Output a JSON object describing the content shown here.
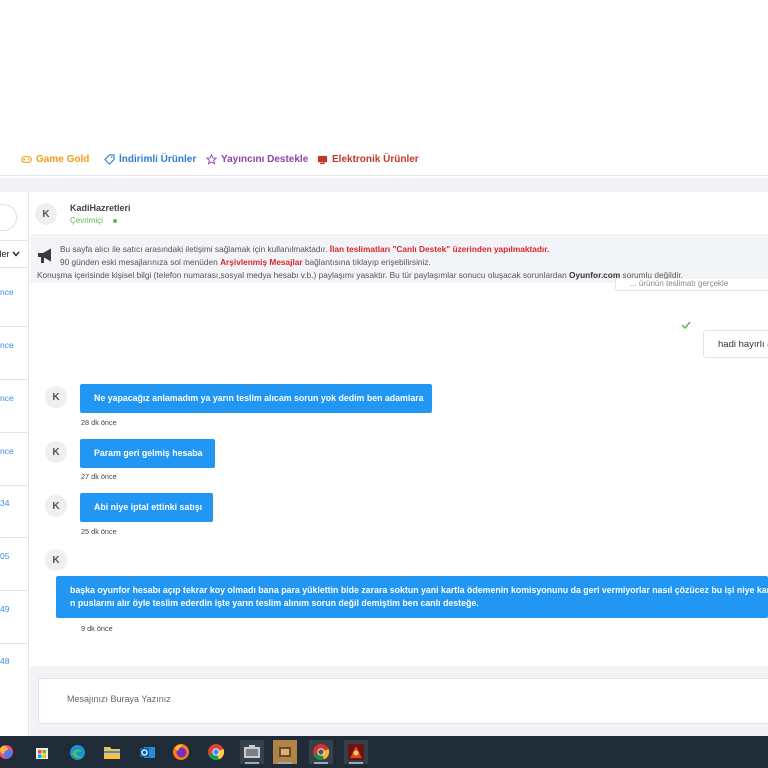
{
  "colors": {
    "accent_blue": "#2196f3",
    "link_blue": "#3a8ee6",
    "online_green": "#5cb85c",
    "alert_red": "#d9262c",
    "nav_game_gold": "#f39c12",
    "nav_discount": "#2d7dd2",
    "nav_streamer": "#8e44ad",
    "nav_electronics": "#c0392b"
  },
  "nav": {
    "items": [
      {
        "label": "Game Gold",
        "icon": "gamepad-icon"
      },
      {
        "label": "İndirimli Ürünler",
        "icon": "tag-icon"
      },
      {
        "label": "Yayıncını Destekle",
        "icon": "star-icon"
      },
      {
        "label": "Elektronik Ürünler",
        "icon": "electronics-icon"
      }
    ]
  },
  "sidebar": {
    "filter_label": "tler",
    "times": [
      "nce",
      "nce",
      "nce",
      "nce",
      "34",
      "05",
      "49",
      "48"
    ]
  },
  "chat": {
    "contact": {
      "initial": "K",
      "name": "KadiHazretleri",
      "status": "Çevrimiçi"
    },
    "notice": {
      "line1_plain": "Bu sayfa alıcı ile satıcı arasındaki iletişimi sağlamak için kullanılmaktadır.",
      "line1_red": "İlan teslimatları \"Canlı Destek\" üzerinden yapılmaktadır.",
      "line2_before": "90 günden eski mesajlarınıza sol menüden",
      "line2_red": "Arşivlenmiş Mesajlar",
      "line2_after": "bağlantısına tıklayıp erişebilirsiniz.",
      "line3_before": "Konuşma içerisinde kişisel bilgi (telefon numarası,sosyal medya hesabı v.b.) paylaşımı yasaktır. Bu tür paylaşımlar sonucu oluşacak sorunlardan",
      "line3_bold": "Oyunfor.com",
      "line3_after": "sorumlu değildir."
    },
    "partial_bubble_text": "... ürünün teslimatı gerçekle",
    "outgoing_last": "hadi hayırlı a",
    "incoming": [
      {
        "initial": "K",
        "text": "Ne yapacağız anlamadım ya yarın teslim alıcam sorun yok dedim ben adamlara",
        "time": "28 dk önce"
      },
      {
        "initial": "K",
        "text": "Param geri gelmiş hesaba",
        "time": "27 dk önce"
      },
      {
        "initial": "K",
        "text": "Abi niye iptal ettinki satışı",
        "time": "25 dk önce"
      },
      {
        "initial": "K",
        "line1": "başka oyunfor hesabı açıp tekrar koy olmadı bana para yüklettin bide zarara soktun yani kartla ödemenin komisyonunu da geri vermiyorlar nasıl çözücez bu işi niye karıştırdı",
        "line2": "n puslarını alır öyle teslim ederdin işte yarın teslim alınım sorun değil demiştim ben canlı desteğe.",
        "time": "9 dk önce"
      }
    ],
    "input_placeholder": "Mesajınızı Buraya Yazınız"
  },
  "taskbar": {
    "icons": [
      "copilot-icon",
      "store-icon",
      "edge-icon",
      "file-explorer-icon",
      "outlook-icon",
      "firefox-icon",
      "chrome-icon",
      "app-icon",
      "folder-app-icon",
      "chrome-profile-icon",
      "game-icon"
    ]
  }
}
